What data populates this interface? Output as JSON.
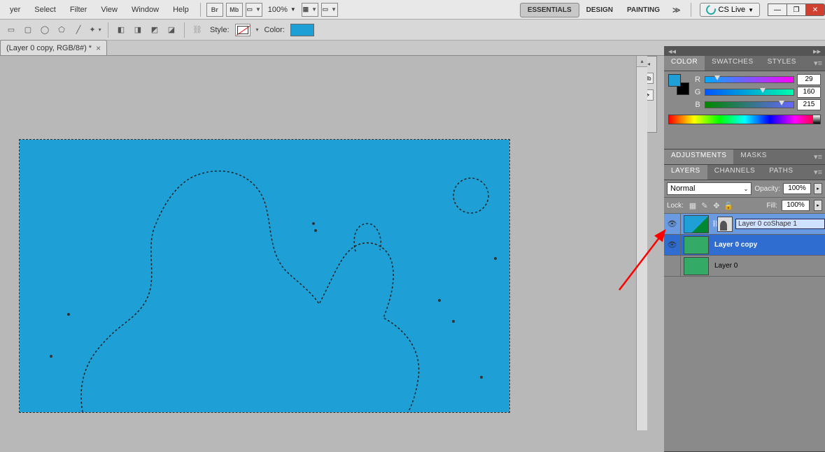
{
  "menu": {
    "items": [
      "yer",
      "Select",
      "Filter",
      "View",
      "Window",
      "Help"
    ],
    "zoom": "100%",
    "workspace": {
      "essentials": "ESSENTIALS",
      "design": "DESIGN",
      "painting": "PAINTING"
    },
    "cslive": "CS Live"
  },
  "options": {
    "style_label": "Style:",
    "color_label": "Color:",
    "color_value": "#1E9FD6"
  },
  "document": {
    "tab": "(Layer 0 copy, RGB/8#) *"
  },
  "panels": {
    "color_tabs": [
      "COLOR",
      "SWATCHES",
      "STYLES"
    ],
    "color": {
      "r_label": "R",
      "g_label": "G",
      "b_label": "B",
      "r": "29",
      "g": "160",
      "b": "215"
    },
    "adj_tabs": [
      "ADJUSTMENTS",
      "MASKS"
    ],
    "layers_tabs": [
      "LAYERS",
      "CHANNELS",
      "PATHS"
    ],
    "layers": {
      "blend": "Normal",
      "opacity_label": "Opacity:",
      "opacity": "100%",
      "lock_label": "Lock:",
      "fill_label": "Fill:",
      "fill": "100%",
      "items": [
        {
          "name": "Layer 0 coShape 1",
          "renaming": "Layer 0 co"
        },
        {
          "name": "Layer 0 copy"
        },
        {
          "name": "Layer 0"
        }
      ]
    }
  }
}
